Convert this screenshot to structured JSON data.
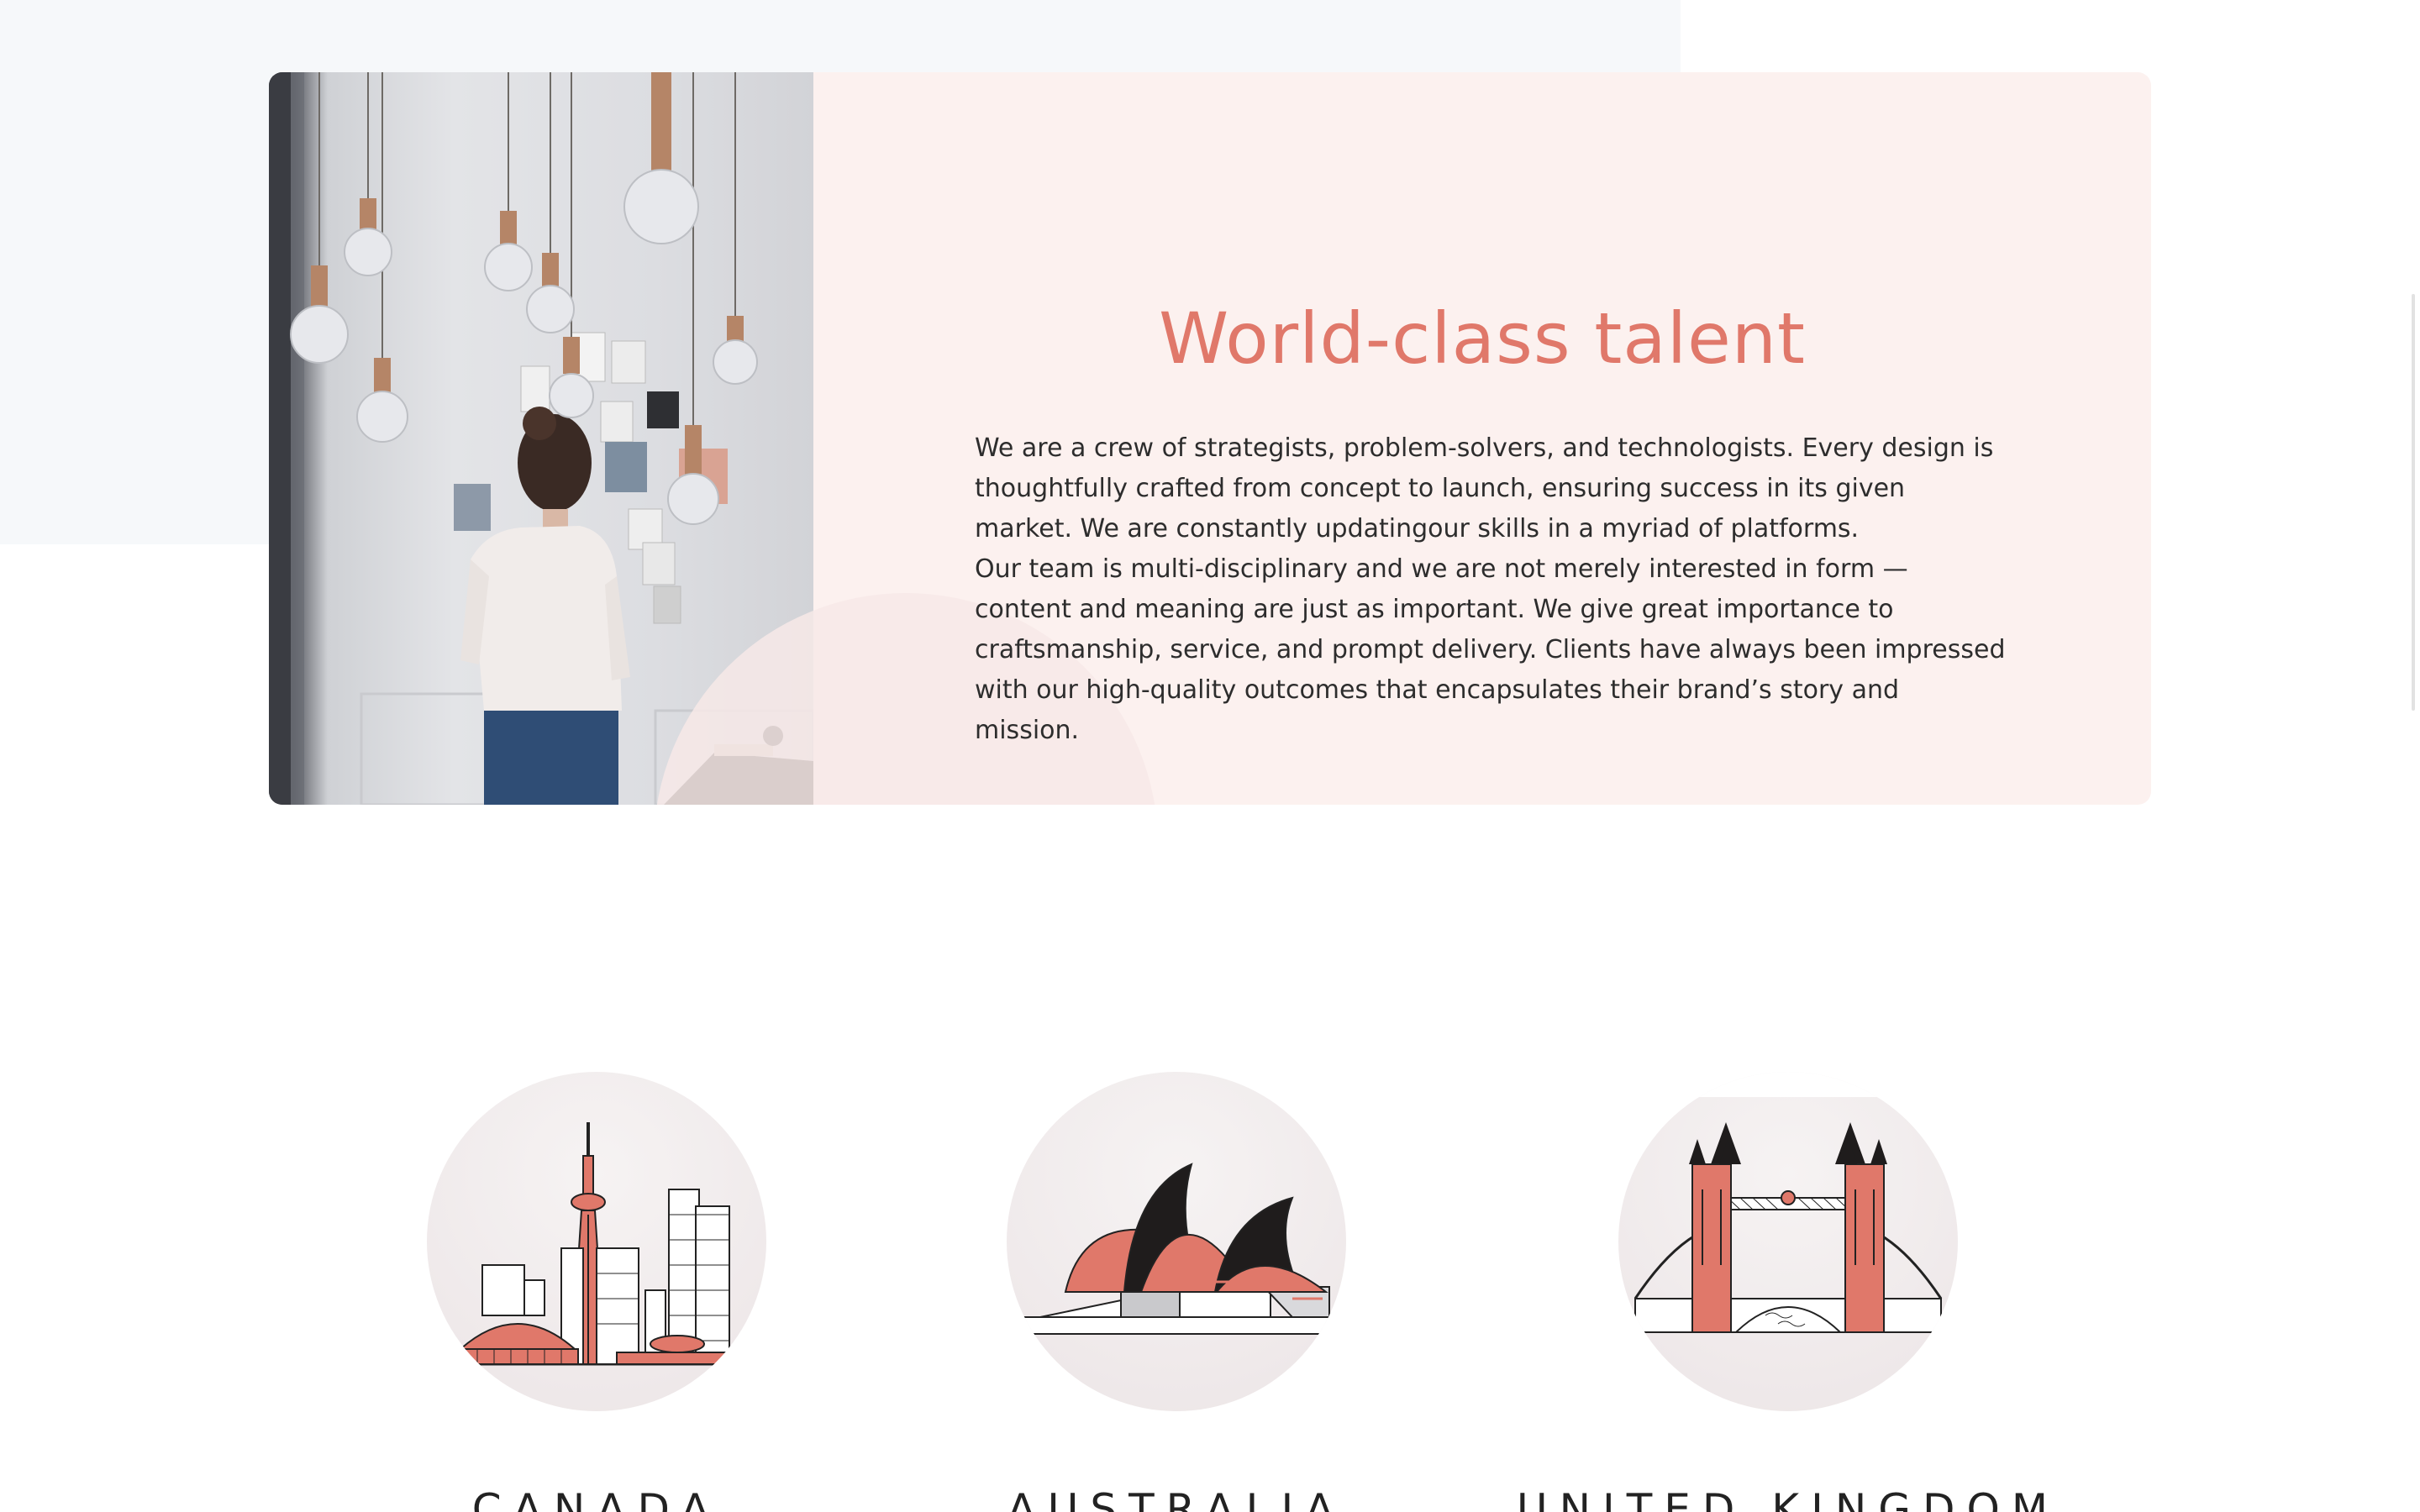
{
  "feature": {
    "title": "World-class talent",
    "paragraphs": [
      "We are a crew of strategists, problem-solvers, and technologists. Every design is thoughtfully crafted from concept to launch, ensuring success in its given market. We are constantly updatingour skills in a myriad of platforms.",
      "Our team is multi-disciplinary and we are not merely interested in form — content and meaning are just as important. We give great importance to craftsmanship, service, and prompt delivery. Clients have always been impressed with our high-quality outcomes that encapsulates their brand’s story and mission."
    ],
    "photo_icon": "woman-looking-at-wall-photo"
  },
  "locations": [
    {
      "name": "CANADA",
      "icon": "toronto-skyline-icon"
    },
    {
      "name": "AUSTRALIA",
      "icon": "sydney-opera-house-icon"
    },
    {
      "name": "UNITED KINGDOM",
      "icon": "tower-bridge-icon"
    }
  ],
  "colors": {
    "accent": "#e0786a",
    "card_bg": "#fcf1ef",
    "text": "#2d2d2d",
    "page_panel": "#f6f8fa"
  }
}
